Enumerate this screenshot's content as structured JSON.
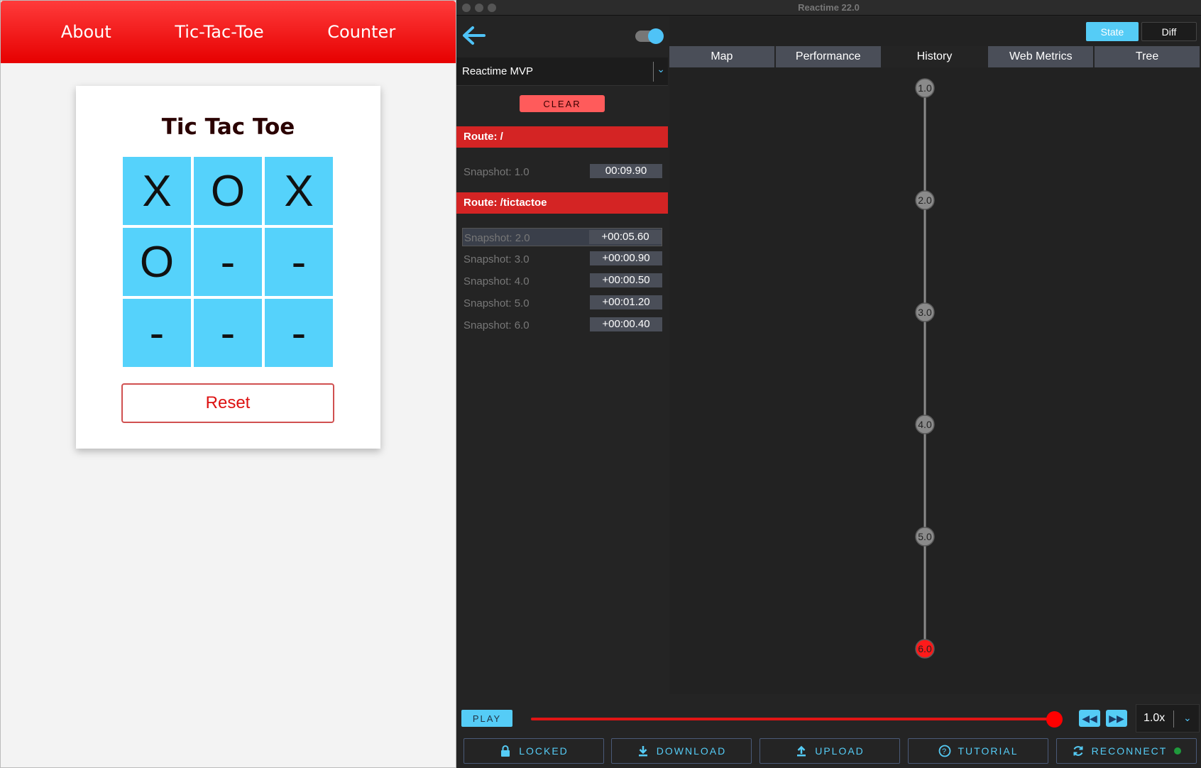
{
  "app": {
    "nav": [
      "About",
      "Tic-Tac-Toe",
      "Counter"
    ],
    "title": "Tic Tac Toe",
    "board": [
      "X",
      "O",
      "X",
      "O",
      "-",
      "-",
      "-",
      "-",
      "-"
    ],
    "reset_label": "Reset"
  },
  "devtools": {
    "window_title": "Reactime 22.0",
    "app_select": "Reactime MVP",
    "clear_label": "CLEAR",
    "routes": [
      {
        "label": "Route: /",
        "snapshots": [
          {
            "label": "Snapshot: 1.0",
            "time": "00:09.90"
          }
        ]
      },
      {
        "label": "Route: /tictactoe",
        "snapshots": [
          {
            "label": "Snapshot: 2.0",
            "time": "+00:05.60"
          },
          {
            "label": "Snapshot: 3.0",
            "time": "+00:00.90"
          },
          {
            "label": "Snapshot: 4.0",
            "time": "+00:00.50"
          },
          {
            "label": "Snapshot: 5.0",
            "time": "+00:01.20"
          },
          {
            "label": "Snapshot: 6.0",
            "time": "+00:00.40"
          }
        ]
      }
    ],
    "selected_snapshot": "Snapshot: 2.0",
    "state_label": "State",
    "diff_label": "Diff",
    "tabs": [
      "Map",
      "Performance",
      "History",
      "Web Metrics",
      "Tree"
    ],
    "active_tab": "History",
    "history_nodes": [
      "1.0",
      "2.0",
      "3.0",
      "4.0",
      "5.0",
      "6.0"
    ],
    "current_node": "6.0",
    "play_label": "PLAY",
    "slider_position": 1.0,
    "speed": "1.0x",
    "footer": {
      "locked": "LOCKED",
      "download": "DOWNLOAD",
      "upload": "UPLOAD",
      "tutorial": "TUTORIAL",
      "reconnect": "RECONNECT"
    },
    "colors": {
      "accent": "#55ccf6",
      "route": "#d42424",
      "node": "#8a8a8a",
      "current_node": "#ff1a1a",
      "connected": "#1f9a3c"
    }
  }
}
